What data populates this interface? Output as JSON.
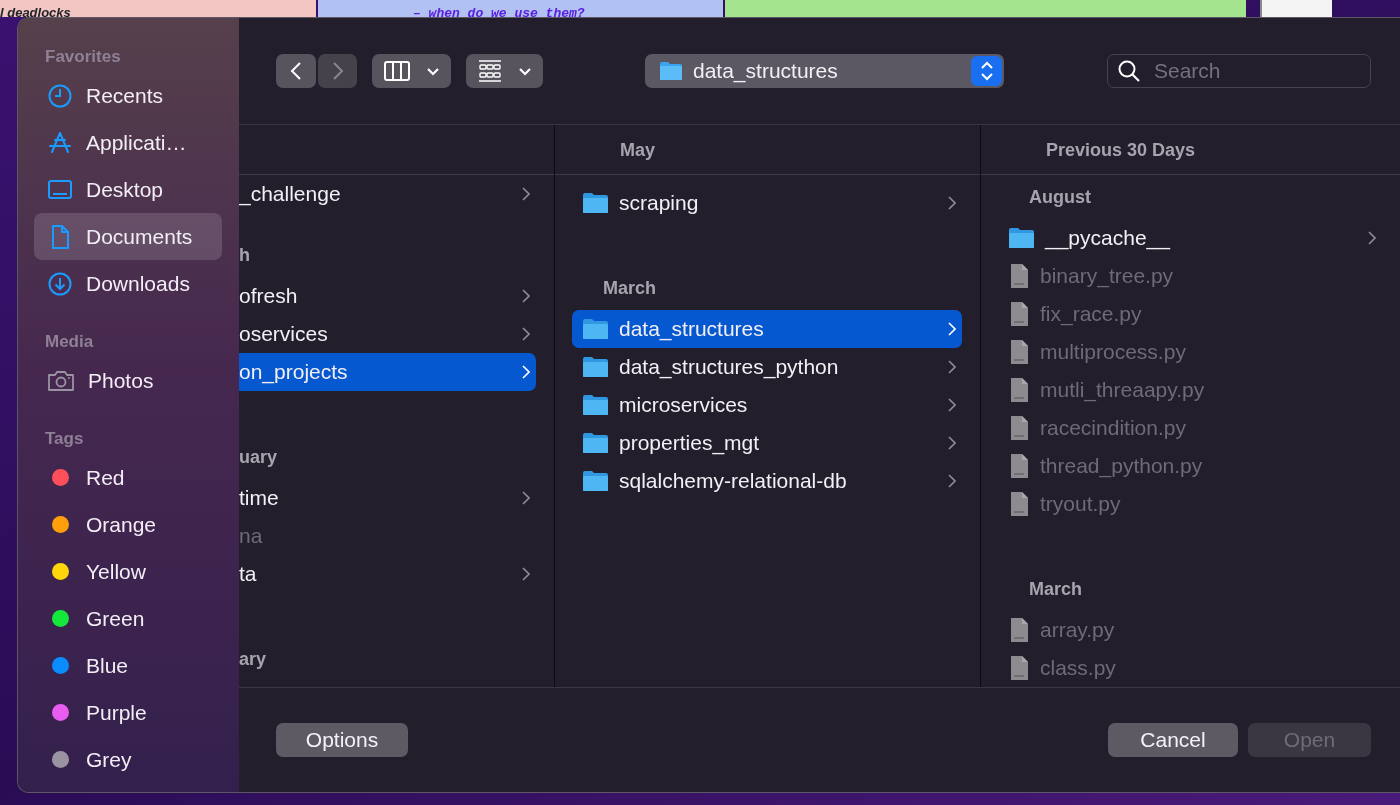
{
  "background": {
    "panels": [
      {
        "kind": "note",
        "color": "#f3c6c4",
        "text": "l deadlocks"
      },
      {
        "kind": "note",
        "color": "#b1c1f2",
        "text": "– when do we use them?"
      },
      {
        "kind": "note",
        "color": "#a5e48e"
      },
      {
        "kind": "thumbnail"
      }
    ]
  },
  "toolbar": {
    "back": {
      "disabled": false
    },
    "forward": {
      "disabled": true
    },
    "path": "data_structures",
    "search": {
      "placeholder": "Search"
    }
  },
  "sidebar": {
    "sections": [
      {
        "title": "Favorites",
        "items": [
          {
            "label": "Recents",
            "selected": false
          },
          {
            "label": "Applicati…",
            "selected": false
          },
          {
            "label": "Desktop",
            "selected": false
          },
          {
            "label": "Documents",
            "selected": true
          },
          {
            "label": "Downloads",
            "selected": false
          }
        ]
      },
      {
        "title": "Media",
        "items": [
          {
            "label": "Photos",
            "selected": false
          }
        ]
      },
      {
        "title": "Tags",
        "items": [
          {
            "label": "Red",
            "color": "#fe4f5a",
            "selected": false
          },
          {
            "label": "Orange",
            "color": "#ff9f0a",
            "selected": false
          },
          {
            "label": "Yellow",
            "color": "#ffd60a",
            "selected": false
          },
          {
            "label": "Green",
            "color": "#14e83c",
            "selected": false
          },
          {
            "label": "Blue",
            "color": "#0a8cff",
            "selected": false
          },
          {
            "label": "Purple",
            "color": "#e85cf0",
            "selected": false
          },
          {
            "label": "Grey",
            "color": "#9a94a2",
            "selected": false
          }
        ]
      }
    ]
  },
  "columns": [
    {
      "kind": "scrolled",
      "items": [
        {
          "kind": "folder",
          "name": "_challenge",
          "selected": false
        },
        {
          "kind": "group",
          "label": "h"
        },
        {
          "kind": "folder",
          "name": "ofresh",
          "selected": false
        },
        {
          "kind": "folder",
          "name": "oservices",
          "selected": false
        },
        {
          "kind": "folder",
          "name": "on_projects",
          "selected": true
        },
        {
          "kind": "group",
          "label": "uary"
        },
        {
          "kind": "folder",
          "name": "time",
          "selected": false
        },
        {
          "kind": "file",
          "name": "na",
          "disabled": true
        },
        {
          "kind": "folder",
          "name": "ta",
          "selected": false
        },
        {
          "kind": "group",
          "label": "ary"
        }
      ]
    },
    {
      "kind": "plain",
      "header": "May",
      "items": [
        {
          "kind": "folder",
          "name": "scraping",
          "selected": false
        },
        {
          "kind": "group",
          "label": "March"
        },
        {
          "kind": "folder",
          "name": "data_structures",
          "selected": true
        },
        {
          "kind": "folder",
          "name": "data_structures_python",
          "selected": false
        },
        {
          "kind": "folder",
          "name": "microservices",
          "selected": false
        },
        {
          "kind": "folder",
          "name": "properties_mgt",
          "selected": false
        },
        {
          "kind": "folder",
          "name": "sqlalchemy-relational-db",
          "selected": false
        }
      ]
    },
    {
      "kind": "plain",
      "header": "Previous 30 Days",
      "items": [
        {
          "kind": "group",
          "label": "August"
        },
        {
          "kind": "folder",
          "name": "__pycache__",
          "selected": false
        },
        {
          "kind": "file",
          "name": "binary_tree.py",
          "disabled": true
        },
        {
          "kind": "file",
          "name": "fix_race.py",
          "disabled": true
        },
        {
          "kind": "file",
          "name": "multiprocess.py",
          "disabled": true
        },
        {
          "kind": "file",
          "name": "mutli_threaapy.py",
          "disabled": true
        },
        {
          "kind": "file",
          "name": "racecindition.py",
          "disabled": true
        },
        {
          "kind": "file",
          "name": "thread_python.py",
          "disabled": true
        },
        {
          "kind": "file",
          "name": "tryout.py",
          "disabled": true
        },
        {
          "kind": "group",
          "label": "March"
        },
        {
          "kind": "file",
          "name": "array.py",
          "disabled": true
        },
        {
          "kind": "file",
          "name": "class.py",
          "disabled": true
        }
      ]
    }
  ],
  "buttons": [
    {
      "kind": "start",
      "label": "Options",
      "disabled": false
    },
    {
      "kind": "end",
      "label": "Cancel",
      "disabled": false
    },
    {
      "kind": "end",
      "label": "Open",
      "disabled": true
    }
  ]
}
